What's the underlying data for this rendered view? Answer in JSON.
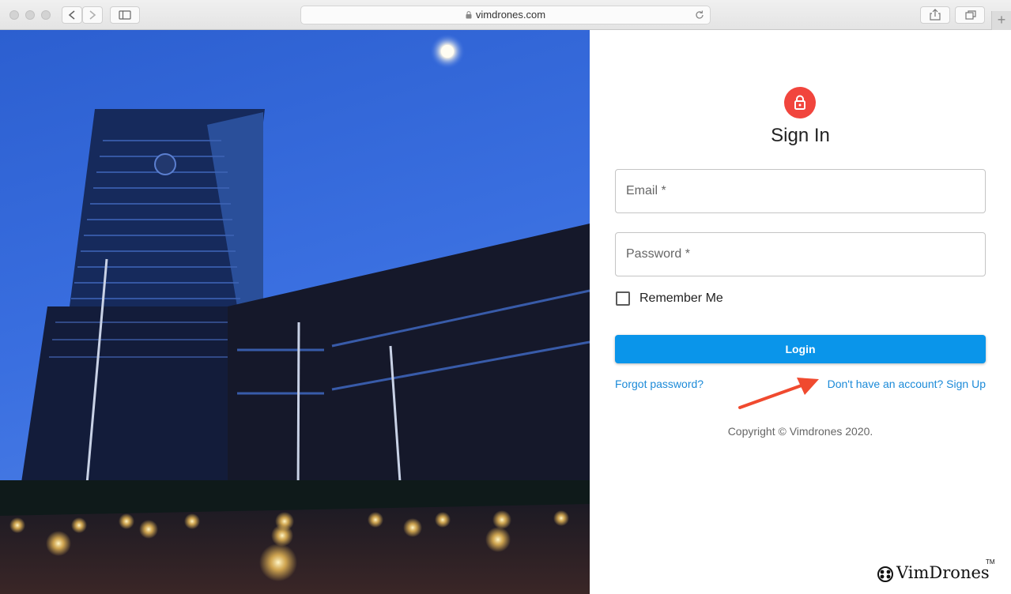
{
  "browser": {
    "url": "vimdrones.com",
    "new_tab_glyph": "+",
    "icons": [
      "back-icon",
      "forward-icon",
      "sidebar-icon",
      "lock-icon",
      "reload-icon",
      "share-icon",
      "tabs-icon"
    ]
  },
  "signin": {
    "title": "Sign In",
    "email_placeholder": "Email *",
    "password_placeholder": "Password *",
    "remember_label": "Remember Me",
    "login_label": "Login",
    "forgot_link": "Forgot password?",
    "signup_link": "Don't have an account? Sign Up",
    "copyright": "Copyright © Vimdrones 2020.",
    "brand": "VimDrones",
    "brand_tm": "TM"
  },
  "colors": {
    "accent": "#0a95ea",
    "avatar": "#f1453d",
    "link": "#1b8ad8",
    "annotation_arrow": "#f04a2f"
  }
}
